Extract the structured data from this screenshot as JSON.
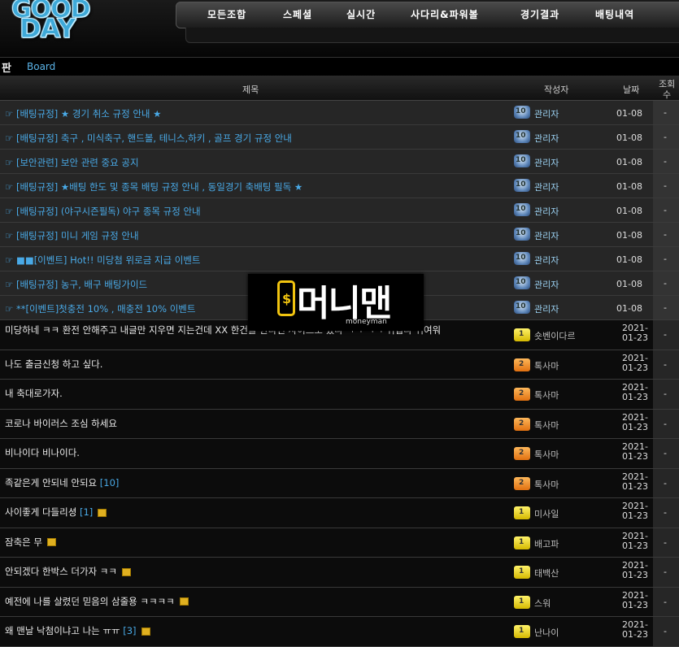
{
  "logo": {
    "line1": "GOOD",
    "line2": "DAY"
  },
  "nav": [
    {
      "label": "모든조합"
    },
    {
      "label": "스페셜"
    },
    {
      "label": "실시간"
    },
    {
      "label": "사다리&파워볼"
    },
    {
      "label": "경기결과"
    },
    {
      "label": "배팅내역"
    }
  ],
  "breadcrumb": {
    "section": "판",
    "board": "Board"
  },
  "table_header": {
    "title": "제목",
    "author": "작성자",
    "date": "날짜",
    "views_line1": "조회",
    "views_line2": "수"
  },
  "notices": [
    {
      "title": "☞ [배팅규정] ★ 경기 취소 규정 안내 ★",
      "level": "10",
      "author": "관리자",
      "date": "01-08",
      "views": "-"
    },
    {
      "title": "☞ [배팅규정] 축구 , 미식축구, 핸드볼, 테니스,하키 , 골프 경기 규정 안내",
      "level": "10",
      "author": "관리자",
      "date": "01-08",
      "views": "-"
    },
    {
      "title": "☞ [보안관련] 보안 관련 중요 공지",
      "level": "10",
      "author": "관리자",
      "date": "01-08",
      "views": "-"
    },
    {
      "title": "☞ [배팅규정] ★배팅 한도 및 종목 배팅 규정 안내 , 동일경기 축배팅 필독 ★",
      "level": "10",
      "author": "관리자",
      "date": "01-08",
      "views": "-"
    },
    {
      "title": "☞ [배팅규정] (야구시즌필독) 야구 종목 규정 안내",
      "level": "10",
      "author": "관리자",
      "date": "01-08",
      "views": "-"
    },
    {
      "title": "☞ [배팅규정] 미니 게임 규정 안내",
      "level": "10",
      "author": "관리자",
      "date": "01-08",
      "views": "-"
    },
    {
      "title": "☞ ■■[이벤트] Hot!! 미당첨 위로금 지급 이벤트",
      "level": "10",
      "author": "관리자",
      "date": "01-08",
      "views": "-"
    },
    {
      "title": "☞ [배팅규정] 농구, 배구 배팅가이드",
      "level": "10",
      "author": "관리자",
      "date": "01-08",
      "views": "-"
    },
    {
      "title": "☞ **[이벤트]첫충전 10% , 매충전 10% 이벤트",
      "level": "10",
      "author": "관리자",
      "date": "01-08",
      "views": "-"
    }
  ],
  "posts": [
    {
      "title": "미당하네 ㅋㅋ 환전 안해주고 내글만 지우면 지는건데 XX 한건를 한다면 사이트도 있나 ㅋㅋ ㅋㅋ 귀엽다 귀여워",
      "count": "",
      "new": false,
      "level": "1",
      "author": "숏벤이다르",
      "date1": "2021-",
      "date2": "01-23",
      "views": "-"
    },
    {
      "title": "나도 출금신청 하고 싶다.",
      "count": "",
      "new": false,
      "level": "2",
      "author": "톡사마",
      "date1": "2021-",
      "date2": "01-23",
      "views": "-"
    },
    {
      "title": "내 축대로가자.",
      "count": "",
      "new": false,
      "level": "2",
      "author": "톡사마",
      "date1": "2021-",
      "date2": "01-23",
      "views": "-"
    },
    {
      "title": "코로나 바이러스 조심 하세요",
      "count": "",
      "new": false,
      "level": "2",
      "author": "톡사마",
      "date1": "2021-",
      "date2": "01-23",
      "views": "-"
    },
    {
      "title": "비나이다 비나이다.",
      "count": "",
      "new": false,
      "level": "2",
      "author": "톡사마",
      "date1": "2021-",
      "date2": "01-23",
      "views": "-"
    },
    {
      "title": "족같은게 안되네 안되요",
      "count": "[10]",
      "new": false,
      "level": "2",
      "author": "톡사마",
      "date1": "2021-",
      "date2": "01-23",
      "views": "-"
    },
    {
      "title": "사이좋게 다들리셩",
      "count": "[1]",
      "new": true,
      "level": "1",
      "author": "미사일",
      "date1": "2021-",
      "date2": "01-23",
      "views": "-"
    },
    {
      "title": "잠축은 무",
      "count": "",
      "new": true,
      "level": "1",
      "author": "배고파",
      "date1": "2021-",
      "date2": "01-23",
      "views": "-"
    },
    {
      "title": "안되겠다 한박스 더가자 ㅋㅋ",
      "count": "",
      "new": true,
      "level": "1",
      "author": "태백산",
      "date1": "2021-",
      "date2": "01-23",
      "views": "-"
    },
    {
      "title": "예전에 나를 살렸던 믿음의 삼줄용 ㅋㅋㅋㅋ",
      "count": "",
      "new": true,
      "level": "1",
      "author": "스워",
      "date1": "2021-",
      "date2": "01-23",
      "views": "-"
    },
    {
      "title": "왜 맨날 낙첨이냐고 나는 ㅠㅠ",
      "count": "[3]",
      "new": true,
      "level": "1",
      "author": "난나이",
      "date1": "2021-",
      "date2": "01-23",
      "views": "-"
    }
  ],
  "watermark": {
    "icon_symbol": "$",
    "text": "머니맨",
    "sub": "moneyman"
  },
  "colors": {
    "notice_link": "#49a9e6",
    "accent_yellow": "#f1c40f",
    "row_bg": "#262626"
  }
}
